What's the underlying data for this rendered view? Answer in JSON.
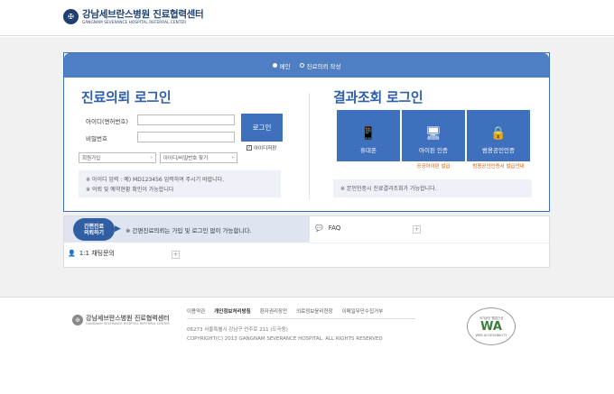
{
  "header": {
    "logo_kr": "강남세브란스병원 진료협력센터",
    "logo_en": "GANGNAM SEVERANCE HOSPITAL REFERRAL CENTER",
    "seal_glyph": "✠"
  },
  "panel": {
    "tabs": [
      {
        "label": "메인",
        "active": true
      },
      {
        "label": "진료의뢰 작성",
        "active": false
      }
    ],
    "left": {
      "title": "진료의뢰 로그인",
      "id_label": "아이디(면허번호)",
      "pw_label": "비밀번호",
      "id_value": "",
      "pw_value": "",
      "login_button": "로그인",
      "save_id": "아이디저장",
      "save_id_checked": true,
      "join_select": "회원가입",
      "find_select": "아이디/비밀번호 찾기",
      "notes": [
        "※ 아이디 입력 : 예) MD123456 입력하여 주시기 바랍니다.",
        "※ 의뢰 및 예약현황 확인이 가능합니다"
      ]
    },
    "right": {
      "title": "결과조회 로그인",
      "options": [
        {
          "label": "휴대폰",
          "icon": "mobile-phone-icon",
          "glyph": "📱",
          "note": ""
        },
        {
          "label": "아이핀 인증",
          "icon": "ipin-monitor-icon",
          "glyph": "🖥",
          "note": "공공아이핀 발급"
        },
        {
          "label": "범용공인인증",
          "icon": "lock-icon",
          "glyph": "🔒",
          "note": "범용공인인증서 발급안내"
        }
      ],
      "note": "※ 본인인증시 진료결과조회가 가능합니다."
    }
  },
  "lower": {
    "simple_badge": "간편진료\n의뢰하기",
    "simple_badge_line1": "간편진료",
    "simple_badge_line2": "의뢰하기",
    "simple_text": "※ 간편진료의뢰는 가입 및 로그인 없이 가능합니다.",
    "faq": "FAQ",
    "chat": "1:1 채팅문의"
  },
  "footer": {
    "logo_kr": "강남세브란스병원 진료협력센터",
    "logo_en": "GANGNAM SEVERANCE HOSPITAL REFERRAL CENTER",
    "links": [
      "이용약관",
      "개인정보처리방침",
      "환자권리장전",
      "의료정보윤리현장",
      "이메일무단수집거부"
    ],
    "bold_link_index": 1,
    "address": "06273 서울특별시 강남구 언주로 211 (도곡동)",
    "copyright": "COPYRIGHT(C) 2013 GANGNAM SEVERANCE HOSPITAL. ALL RIGHTS RESERVED",
    "badge_top": "국가공인 웹접근성",
    "badge_mark": "WA",
    "badge_bottom": "WEB ACCESSIBILITY"
  },
  "colors": {
    "brand_navy": "#1f3f72",
    "accent_blue": "#3e70bd",
    "note_orange": "#e05a00"
  }
}
